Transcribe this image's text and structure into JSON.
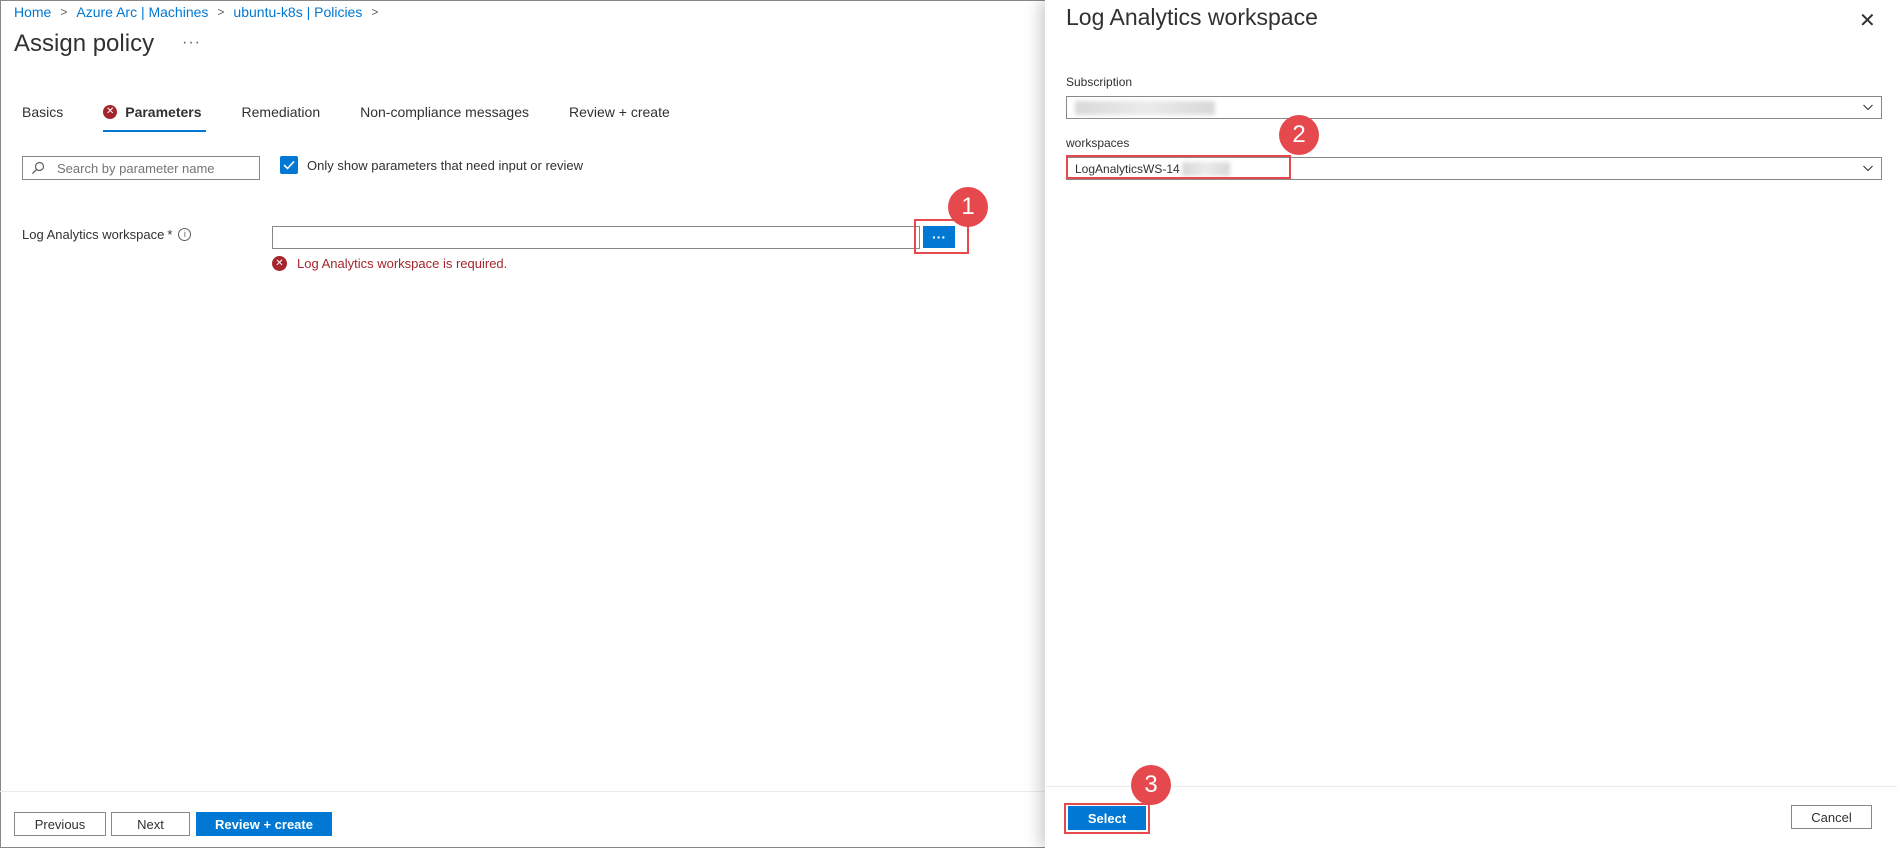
{
  "breadcrumb": {
    "items": [
      "Home",
      "Azure Arc | Machines",
      "ubuntu-k8s | Policies"
    ],
    "separator": ">"
  },
  "page": {
    "title": "Assign policy",
    "more": "···"
  },
  "tabs": [
    {
      "label": "Basics",
      "active": false,
      "error": false
    },
    {
      "label": "Parameters",
      "active": true,
      "error": true
    },
    {
      "label": "Remediation",
      "active": false,
      "error": false
    },
    {
      "label": "Non-compliance messages",
      "active": false,
      "error": false
    },
    {
      "label": "Review + create",
      "active": false,
      "error": false
    }
  ],
  "filters": {
    "search_placeholder": "Search by parameter name",
    "only_show_label": "Only show parameters that need input or review",
    "only_show_checked": true
  },
  "parameter": {
    "label": "Log Analytics workspace",
    "required_mark": "*",
    "info_glyph": "i",
    "value": "",
    "browse_label": "···",
    "error_message": "Log Analytics workspace is required."
  },
  "footer": {
    "previous": "Previous",
    "next": "Next",
    "review_create": "Review + create"
  },
  "panel": {
    "title": "Log Analytics workspace",
    "close": "✕",
    "subscription_label": "Subscription",
    "workspaces_label": "workspaces",
    "workspace_value": "LogAnalyticsWS-14",
    "select": "Select",
    "cancel": "Cancel"
  },
  "annotations": [
    "1",
    "2",
    "3"
  ],
  "colors": {
    "accent": "#0078d4",
    "error": "#a4262c",
    "highlight": "#e5484d"
  }
}
